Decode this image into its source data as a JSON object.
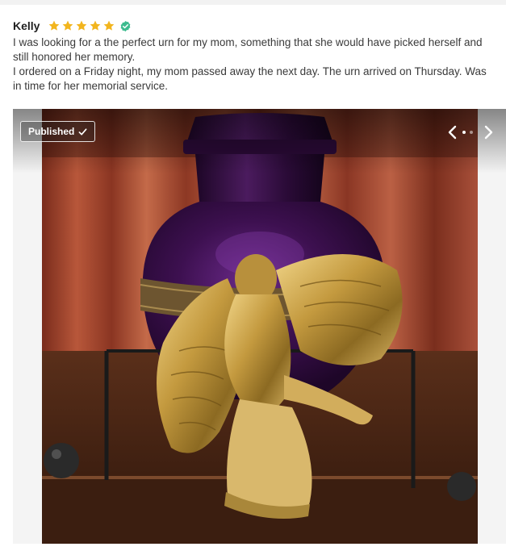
{
  "review": {
    "reviewer_name": "Kelly",
    "rating": 5,
    "rating_max": 5,
    "star_color": "#f2b51e",
    "verified_icon": "verified-check-icon",
    "verified_color": "#3dbb8f",
    "text_lines": [
      "I was looking for a the perfect urn for my mom, something that she would have picked herself and still honored her memory.",
      "I ordered on a Friday night, my mom passed away the next day. The urn arrived on Thursday. Was in time for her memorial service."
    ]
  },
  "gallery": {
    "badge_label": "Published",
    "badge_icon": "checkmark-icon",
    "prev_icon": "chevron-left-icon",
    "next_icon": "chevron-right-icon",
    "dot_count": 2,
    "active_dot": 0,
    "photo_subject": "photo-urn-with-angel"
  }
}
